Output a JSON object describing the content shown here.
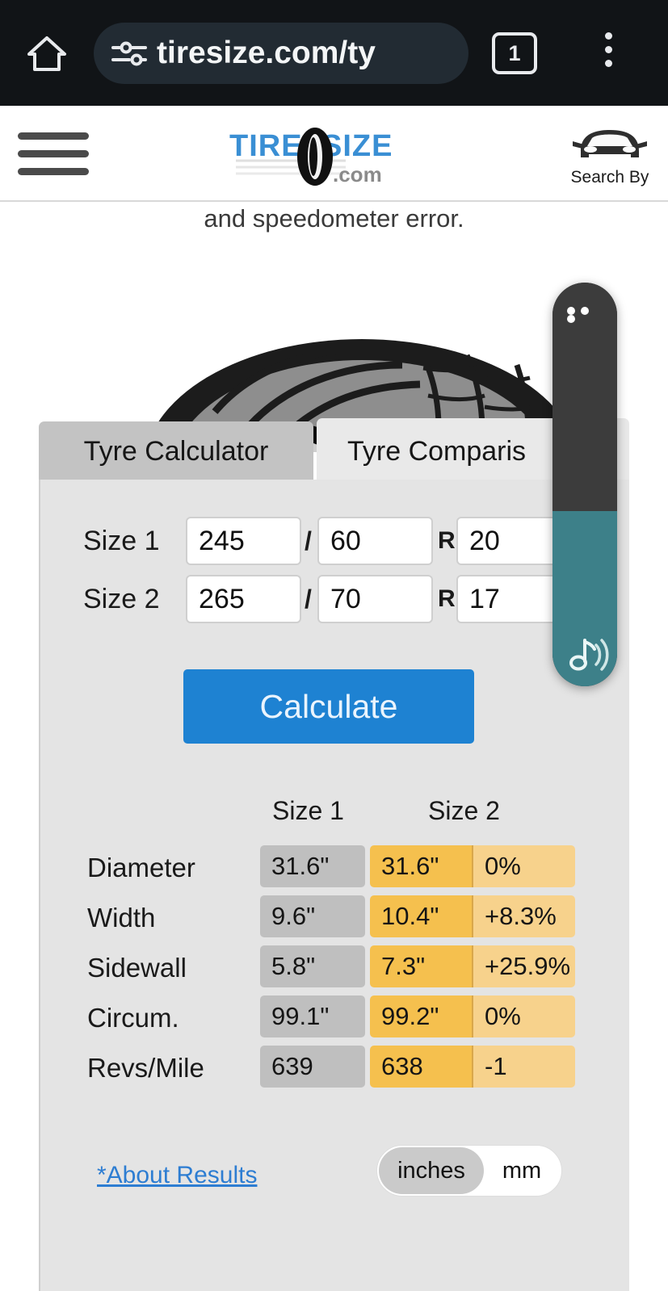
{
  "browser": {
    "url": "tiresize.com/ty",
    "tab_count": "1",
    "home_icon": "home-icon",
    "tune_icon": "tune-sliders-icon",
    "menu_icon": "kebab-menu-icon"
  },
  "site_header": {
    "menu_icon": "hamburger-menu-icon",
    "logo_tire": "TIRE",
    "logo_size": "SIZE",
    "logo_com": ".com",
    "search_by_label": "Search By",
    "car_icon": "car-front-icon"
  },
  "page": {
    "intro_text": "and speedometer error.",
    "tire_photo": "tire-photo"
  },
  "tabs": [
    {
      "label": "Tyre Calculator",
      "active": false
    },
    {
      "label": "Tyre Comparis",
      "active": true
    }
  ],
  "inputs": {
    "size1": {
      "label": "Size 1",
      "width": "245",
      "ratio": "60",
      "diameter": "20"
    },
    "size2": {
      "label": "Size 2",
      "width": "265",
      "ratio": "70",
      "diameter": "17"
    },
    "separator_slash": "/",
    "separator_r": "R"
  },
  "calculate_button": "Calculate",
  "results": {
    "headers": {
      "col1": "Size 1",
      "col2": "Size 2"
    },
    "rows": [
      {
        "name": "Diameter",
        "size1": "31.6\"",
        "size2": "31.6\"",
        "diff": "0%"
      },
      {
        "name": "Width",
        "size1": "9.6\"",
        "size2": "10.4\"",
        "diff": "+8.3%"
      },
      {
        "name": "Sidewall",
        "size1": "5.8\"",
        "size2": "7.3\"",
        "diff": "+25.9%"
      },
      {
        "name": "Circum.",
        "size1": "99.1\"",
        "size2": "99.2\"",
        "diff": "0%"
      },
      {
        "name": "Revs/Mile",
        "size1": "639",
        "size2": "638",
        "diff": "-1"
      }
    ]
  },
  "footer": {
    "about_link": "*About Results",
    "units": {
      "selected": "inches",
      "other": "mm"
    }
  },
  "floating_widget": {
    "dots_icon": "more-dots-icon",
    "sound_icon": "music-note-sound-icon"
  },
  "colors": {
    "accent_blue": "#1e82d2",
    "panel_bg": "#e4e4e4",
    "size1_cell": "#bfbfbf",
    "size2_cell": "#f5c04e",
    "diff_cell": "#f7d28c",
    "widget_dark": "#3c3c3c",
    "widget_teal": "#3d8089",
    "link_blue": "#2d7dd2",
    "chrome_bg": "#111417"
  }
}
